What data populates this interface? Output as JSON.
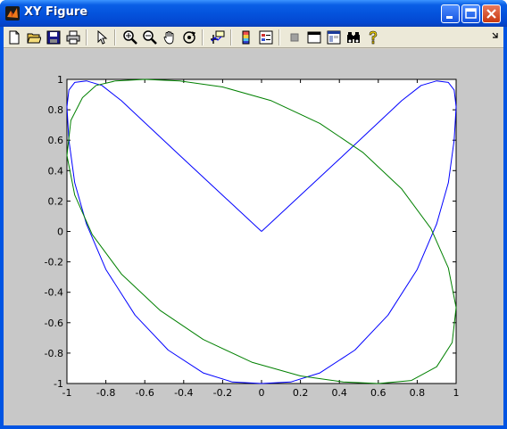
{
  "window": {
    "title": "XY Figure",
    "app_icon": "matlab-logo-icon",
    "title_color": "#ffffff",
    "titlebar_color": "#0453dd"
  },
  "toolbar": {
    "tools": [
      {
        "name": "new-figure",
        "icon": "new-document-icon"
      },
      {
        "name": "open-file",
        "icon": "open-folder-icon"
      },
      {
        "name": "save-figure",
        "icon": "save-disk-icon"
      },
      {
        "name": "print-figure",
        "icon": "printer-icon"
      },
      {
        "name": "edit-plot",
        "icon": "arrow-pointer-icon"
      },
      {
        "name": "zoom-in",
        "icon": "zoom-in-icon"
      },
      {
        "name": "zoom-out",
        "icon": "zoom-out-icon"
      },
      {
        "name": "pan",
        "icon": "hand-icon"
      },
      {
        "name": "rotate-3d",
        "icon": "rotate-icon"
      },
      {
        "name": "data-cursor",
        "icon": "data-cursor-icon"
      },
      {
        "name": "insert-colorbar",
        "icon": "colorbar-icon"
      },
      {
        "name": "insert-legend",
        "icon": "legend-icon"
      },
      {
        "name": "hide-plot-tools",
        "icon": "gray-square-icon"
      },
      {
        "name": "show-plot-tools",
        "icon": "window-icon"
      },
      {
        "name": "dock-figure",
        "icon": "dock-window-icon"
      },
      {
        "name": "find",
        "icon": "binoculars-icon"
      },
      {
        "name": "help",
        "icon": "help-question-icon"
      }
    ],
    "overflow_icon": "chevron-down-icon"
  },
  "chart_data": {
    "type": "line",
    "title": "",
    "xlabel": "",
    "ylabel": "",
    "xlim": [
      -1,
      1
    ],
    "ylim": [
      -1,
      1
    ],
    "grid": false,
    "legend": "none",
    "x_ticks": [
      "-1",
      "-0.8",
      "-0.6",
      "-0.4",
      "-0.2",
      "0",
      "0.2",
      "0.4",
      "0.6",
      "0.8",
      "1"
    ],
    "y_ticks": [
      "1",
      "0.8",
      "0.6",
      "0.4",
      "0.2",
      "0",
      "-0.2",
      "-0.4",
      "-0.6",
      "-0.8",
      "-1"
    ],
    "series": [
      {
        "color": "#0000ff",
        "points": [
          [
            0,
            0
          ],
          [
            0.42,
            0.5
          ],
          [
            0.72,
            0.86
          ],
          [
            0.82,
            0.96
          ],
          [
            0.9,
            0.99
          ],
          [
            0.96,
            0.98
          ],
          [
            0.99,
            0.93
          ],
          [
            1,
            0.82
          ],
          [
            0.99,
            0.6
          ],
          [
            0.96,
            0.32
          ],
          [
            0.9,
            0.05
          ],
          [
            0.8,
            -0.25
          ],
          [
            0.65,
            -0.55
          ],
          [
            0.48,
            -0.78
          ],
          [
            0.3,
            -0.93
          ],
          [
            0.15,
            -0.99
          ],
          [
            0,
            -1
          ],
          [
            -0.15,
            -0.99
          ],
          [
            -0.3,
            -0.93
          ],
          [
            -0.48,
            -0.78
          ],
          [
            -0.65,
            -0.55
          ],
          [
            -0.8,
            -0.25
          ],
          [
            -0.9,
            0.05
          ],
          [
            -0.96,
            0.32
          ],
          [
            -0.99,
            0.6
          ],
          [
            -1,
            0.82
          ],
          [
            -0.99,
            0.93
          ],
          [
            -0.96,
            0.98
          ],
          [
            -0.9,
            0.99
          ],
          [
            -0.82,
            0.96
          ],
          [
            -0.72,
            0.86
          ],
          [
            -0.42,
            0.5
          ],
          [
            0,
            0
          ]
        ]
      },
      {
        "color": "#008000",
        "points": [
          [
            -0.85,
            0.96
          ],
          [
            -0.75,
            0.99
          ],
          [
            -0.6,
            1
          ],
          [
            -0.42,
            0.99
          ],
          [
            -0.2,
            0.95
          ],
          [
            0.05,
            0.86
          ],
          [
            0.3,
            0.71
          ],
          [
            0.52,
            0.52
          ],
          [
            0.72,
            0.28
          ],
          [
            0.87,
            0.02
          ],
          [
            0.96,
            -0.24
          ],
          [
            1,
            -0.5
          ],
          [
            0.98,
            -0.73
          ],
          [
            0.9,
            -0.89
          ],
          [
            0.77,
            -0.98
          ],
          [
            0.6,
            -1
          ],
          [
            0.42,
            -0.99
          ],
          [
            0.2,
            -0.95
          ],
          [
            -0.05,
            -0.86
          ],
          [
            -0.3,
            -0.71
          ],
          [
            -0.52,
            -0.52
          ],
          [
            -0.72,
            -0.28
          ],
          [
            -0.87,
            -0.02
          ],
          [
            -0.96,
            0.24
          ],
          [
            -1,
            0.5
          ],
          [
            -0.98,
            0.73
          ],
          [
            -0.92,
            0.88
          ],
          [
            -0.85,
            0.96
          ]
        ]
      }
    ]
  }
}
